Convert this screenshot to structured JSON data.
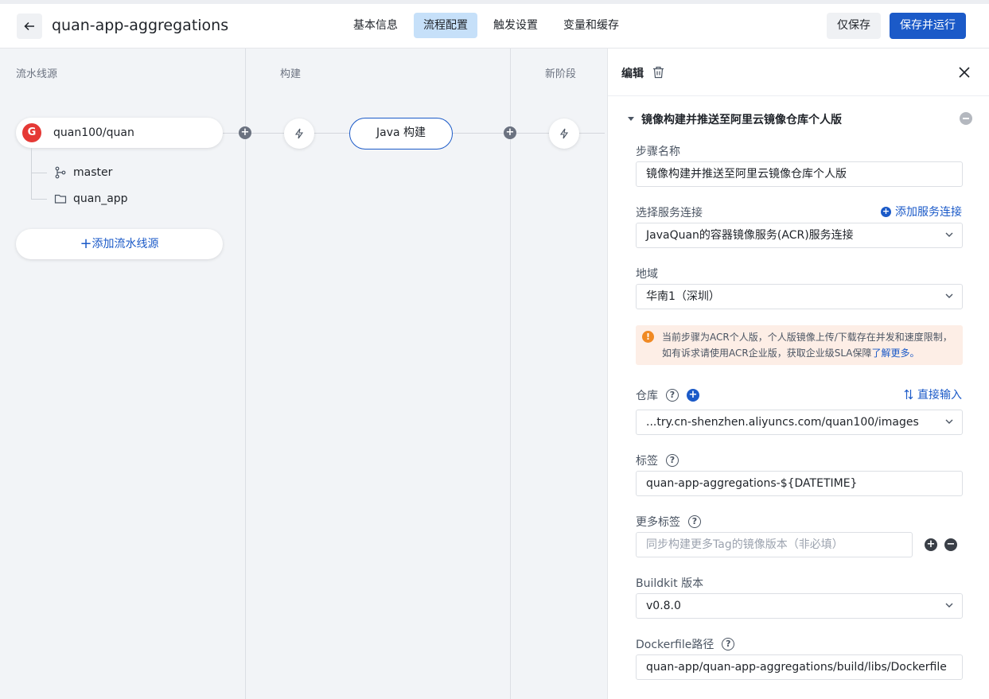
{
  "header": {
    "app_title": "quan-app-aggregations",
    "tabs": [
      {
        "label": "基本信息",
        "active": false
      },
      {
        "label": "流程配置",
        "active": true
      },
      {
        "label": "触发设置",
        "active": false
      },
      {
        "label": "变量和缓存",
        "active": false
      }
    ],
    "save_only_label": "仅保存",
    "save_run_label": "保存并运行"
  },
  "canvas": {
    "columns": [
      {
        "title": "流水线源"
      },
      {
        "title": "构建"
      },
      {
        "title": "新阶段"
      }
    ],
    "source": {
      "logo_letter": "G",
      "name": "quan100/quan",
      "branch": "master",
      "path": "quan_app"
    },
    "add_source_label": "添加流水线源",
    "job_name": "Java 构建"
  },
  "panel": {
    "title": "编辑",
    "step_title": "镜像构建并推送至阿里云镜像仓库个人版",
    "fields": {
      "step_name_label": "步骤名称",
      "step_name_value": "镜像构建并推送至阿里云镜像仓库个人版",
      "service_conn_label": "选择服务连接",
      "add_service_conn": "添加服务连接",
      "service_conn_value": "JavaQuan的容器镜像服务(ACR)服务连接",
      "region_label": "地域",
      "region_value": "华南1（深圳）",
      "warning_text": "当前步骤为ACR个人版，个人版镜像上传/下载存在并发和速度限制，如有诉求请使用ACR企业版，获取企业级SLA保障",
      "warning_link": "了解更多。",
      "repo_label": "仓库",
      "direct_input": "直接输入",
      "repo_value": "...try.cn-shenzhen.aliyuncs.com/quan100/images",
      "tag_label": "标签",
      "tag_value": "quan-app-aggregations-${DATETIME}",
      "more_tags_label": "更多标签",
      "more_tags_placeholder": "同步构建更多Tag的镜像版本（非必填）",
      "buildkit_label": "Buildkit 版本",
      "buildkit_value": "v0.8.0",
      "dockerfile_label": "Dockerfile路径",
      "dockerfile_value": "quan-app/quan-app-aggregations/build/libs/Dockerfile"
    }
  },
  "colors": {
    "primary": "#1b5ac8",
    "active_tab_bg": "#c6e0f9",
    "warning_bg": "#fdeee6",
    "warning_icon": "#f08a24",
    "gitee_red": "#e53935"
  }
}
